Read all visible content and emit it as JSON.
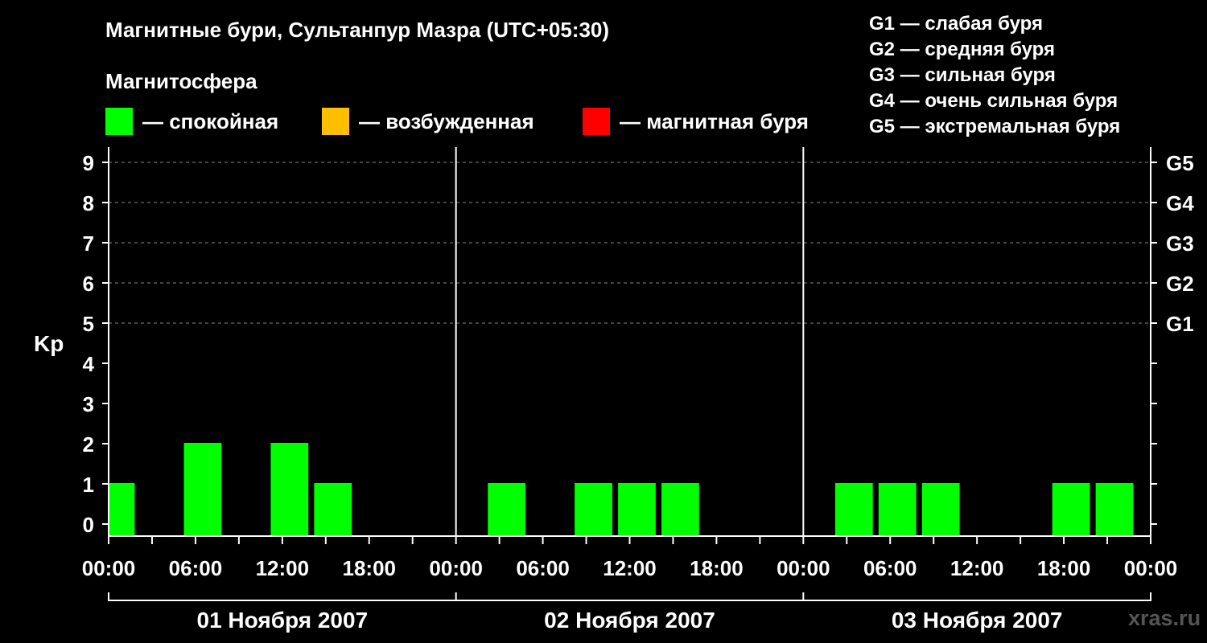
{
  "chart_data": {
    "type": "bar",
    "title": "Магнитные бури, Сультанпур Мазра (UTC+05:30)",
    "subtitle": "Магнитосфера",
    "ylabel": "Kp",
    "ylim": [
      0,
      9
    ],
    "yticks": [
      "0",
      "1",
      "2",
      "3",
      "4",
      "5",
      "6",
      "7",
      "8",
      "9"
    ],
    "g_levels": [
      {
        "label": "G1",
        "kp": 5
      },
      {
        "label": "G2",
        "kp": 6
      },
      {
        "label": "G3",
        "kp": 7
      },
      {
        "label": "G4",
        "kp": 8
      },
      {
        "label": "G5",
        "kp": 9
      }
    ],
    "g_legend": [
      "G1 — слабая буря",
      "G2 — средняя буря",
      "G3 — сильная буря",
      "G4 — очень сильная буря",
      "G5 — экстремальная буря"
    ],
    "state_legend": [
      {
        "label": "— спокойная",
        "color": "#00ff00"
      },
      {
        "label": "— возбужденная",
        "color": "#ffbf00"
      },
      {
        "label": "— магнитная буря",
        "color": "#ff0000"
      }
    ],
    "xticks": [
      "00:00",
      "06:00",
      "12:00",
      "18:00",
      "00:00",
      "06:00",
      "12:00",
      "18:00",
      "00:00",
      "06:00",
      "12:00",
      "18:00",
      "00:00"
    ],
    "days": [
      "01 Ноября 2007",
      "02 Ноября 2007",
      "03 Ноября 2007"
    ],
    "bar_color": "#00ff00",
    "series": [
      {
        "day": 0,
        "start_hour": 0.0,
        "end_hour": 1.8,
        "kp": 1
      },
      {
        "day": 0,
        "start_hour": 5.2,
        "end_hour": 7.8,
        "kp": 2
      },
      {
        "day": 0,
        "start_hour": 11.2,
        "end_hour": 13.8,
        "kp": 2
      },
      {
        "day": 0,
        "start_hour": 14.2,
        "end_hour": 16.8,
        "kp": 1
      },
      {
        "day": 1,
        "start_hour": 2.2,
        "end_hour": 4.8,
        "kp": 1
      },
      {
        "day": 1,
        "start_hour": 8.2,
        "end_hour": 10.8,
        "kp": 1
      },
      {
        "day": 1,
        "start_hour": 11.2,
        "end_hour": 13.8,
        "kp": 1
      },
      {
        "day": 1,
        "start_hour": 14.2,
        "end_hour": 16.8,
        "kp": 1
      },
      {
        "day": 2,
        "start_hour": 2.2,
        "end_hour": 4.8,
        "kp": 1
      },
      {
        "day": 2,
        "start_hour": 5.2,
        "end_hour": 7.8,
        "kp": 1
      },
      {
        "day": 2,
        "start_hour": 8.2,
        "end_hour": 10.8,
        "kp": 1
      },
      {
        "day": 2,
        "start_hour": 17.2,
        "end_hour": 19.8,
        "kp": 1
      },
      {
        "day": 2,
        "start_hour": 20.2,
        "end_hour": 22.8,
        "kp": 1
      }
    ],
    "grid": "dashed at Kp 5-9"
  },
  "watermark": "xras.ru"
}
